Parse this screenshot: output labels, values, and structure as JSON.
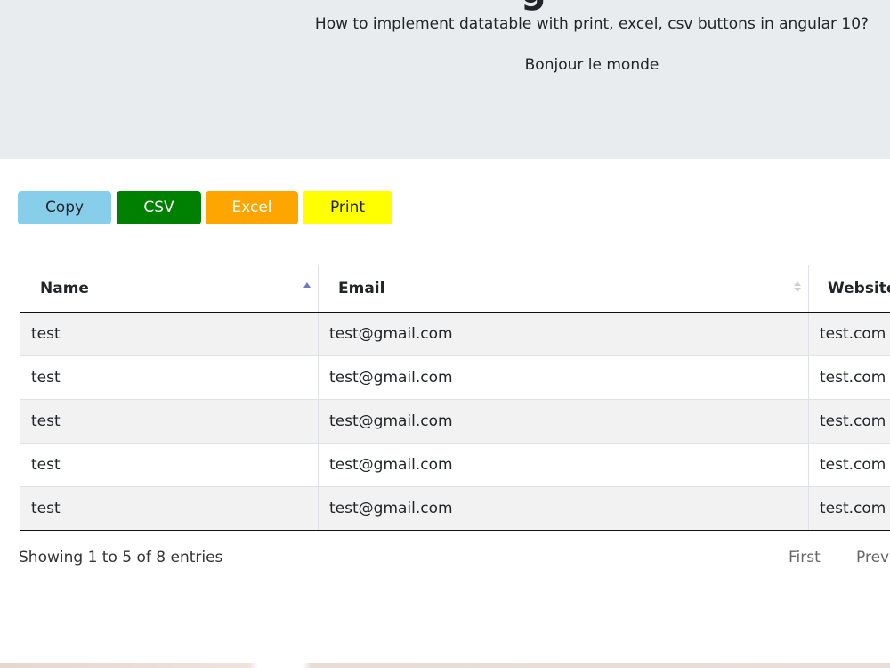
{
  "header": {
    "title_fragment": "g",
    "subtitle": "How to implement datatable with print, excel, csv buttons in angular 10?",
    "greeting": "Bonjour le monde",
    "background": "#e9ecef"
  },
  "buttons": [
    {
      "label": "Copy",
      "bg": "#87ceeb",
      "fg": "#212529"
    },
    {
      "label": "CSV",
      "bg": "#008000",
      "fg": "#ffffff"
    },
    {
      "label": "Excel",
      "bg": "#ffa500",
      "fg": "#ffffff"
    },
    {
      "label": "Print",
      "bg": "#ffff00",
      "fg": "#212529"
    }
  ],
  "table": {
    "columns": [
      {
        "label": "Name",
        "sort": "ascending"
      },
      {
        "label": "Email",
        "sort": "none"
      },
      {
        "label": "Website",
        "sort": "none"
      }
    ],
    "rows": [
      {
        "name": "test",
        "email": "test@gmail.com",
        "website": "test.com"
      },
      {
        "name": "test",
        "email": "test@gmail.com",
        "website": "test.com"
      },
      {
        "name": "test",
        "email": "test@gmail.com",
        "website": "test.com"
      },
      {
        "name": "test",
        "email": "test@gmail.com",
        "website": "test.com"
      },
      {
        "name": "test",
        "email": "test@gmail.com",
        "website": "test.com"
      }
    ],
    "stripe_color": "#f2f2f2",
    "sort_active_color": "#6f78c9",
    "sort_inactive_color": "#cfcfcf"
  },
  "footer": {
    "info": "Showing 1 to 5 of 8 entries",
    "pager": {
      "first": "First",
      "previous": "Previous"
    }
  }
}
